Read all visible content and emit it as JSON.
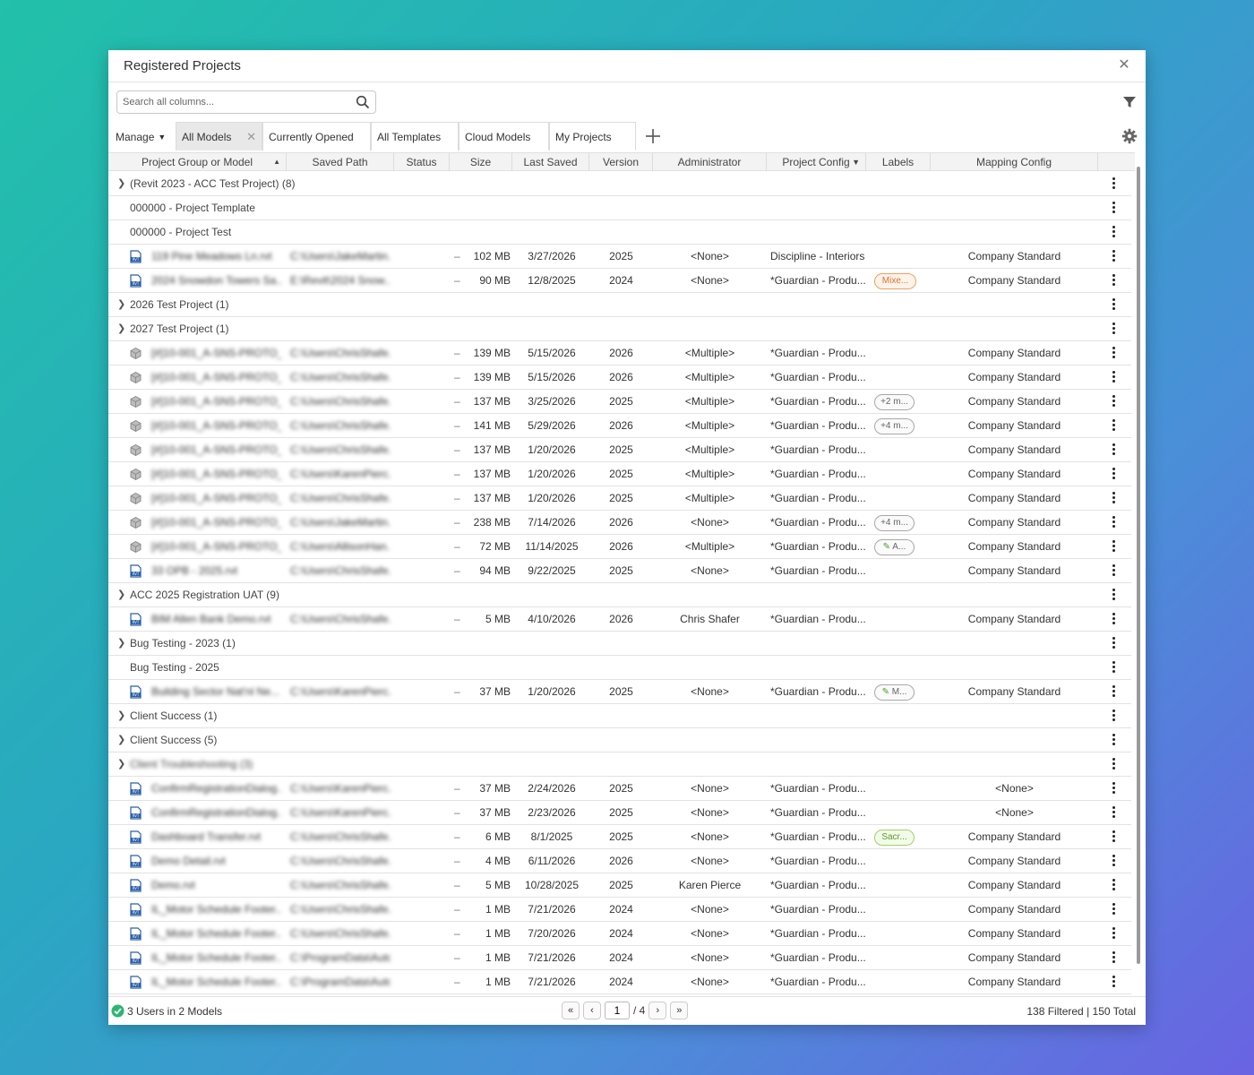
{
  "window": {
    "title": "Registered Projects"
  },
  "search": {
    "placeholder": "Search all columns..."
  },
  "manage_label": "Manage",
  "tabs": [
    {
      "label": "All Models",
      "active": true,
      "closable": true
    },
    {
      "label": "Currently Opened",
      "active": false
    },
    {
      "label": "All Templates",
      "active": false
    },
    {
      "label": "Cloud Models",
      "active": false
    },
    {
      "label": "My Projects",
      "active": false
    }
  ],
  "columns": [
    "Project Group or Model",
    "Saved Path",
    "Status",
    "Size",
    "Last Saved",
    "Version",
    "Administrator",
    "Project Config",
    "Labels",
    "Mapping Config"
  ],
  "rows": [
    {
      "type": "group",
      "caret": true,
      "name": "(Revit 2023 - ACC Test Project) (8)"
    },
    {
      "type": "group",
      "caret": false,
      "name": "000000 - Project Template"
    },
    {
      "type": "group",
      "caret": false,
      "name": "000000 - Project Test"
    },
    {
      "type": "model",
      "icon": "rvt",
      "name": "119 Pine Meadows Ln.rvt",
      "path": "C:\\Users\\JakeMartin...",
      "status": "–",
      "size": "102 MB",
      "saved": "3/27/2026",
      "version": "2025",
      "admin": "<None>",
      "config": "Discipline - Interiors",
      "config_blue": false,
      "label": "",
      "label_style": "",
      "mapping": "Company Standard"
    },
    {
      "type": "model",
      "icon": "rvt",
      "name": "2024 Snowdon Towers Sa...",
      "path": "E:\\Revit\\2024 Snow...",
      "status": "–",
      "size": "90 MB",
      "saved": "12/8/2025",
      "version": "2024",
      "admin": "<None>",
      "config": "*Guardian - Produ...",
      "config_blue": false,
      "label": "Mixe...",
      "label_style": "orange",
      "mapping": "Company Standard"
    },
    {
      "type": "group",
      "caret": true,
      "name": "2026 Test Project (1)"
    },
    {
      "type": "group",
      "caret": true,
      "name": "2027 Test Project (1)"
    },
    {
      "type": "model",
      "icon": "cloud",
      "name": "[#]10-001_A-SNS-PROTO_...",
      "path": "C:\\Users\\ChrisShafe...",
      "status": "–",
      "size": "139 MB",
      "saved": "5/15/2026",
      "version": "2026",
      "admin": "<Multiple>",
      "config": "*Guardian - Produ...",
      "config_blue": false,
      "label": "",
      "label_style": "",
      "mapping": "Company Standard"
    },
    {
      "type": "model",
      "icon": "cloud",
      "name": "[#]10-001_A-SNS-PROTO_...",
      "path": "C:\\Users\\ChrisShafe...",
      "status": "–",
      "size": "139 MB",
      "saved": "5/15/2026",
      "version": "2026",
      "admin": "<Multiple>",
      "config": "*Guardian - Produ...",
      "config_blue": false,
      "label": "",
      "label_style": "",
      "mapping": "Company Standard"
    },
    {
      "type": "model",
      "icon": "cloud",
      "name": "[#]10-001_A-SNS-PROTO_...",
      "path": "C:\\Users\\ChrisShafe...",
      "status": "–",
      "size": "137 MB",
      "saved": "3/25/2026",
      "version": "2025",
      "admin": "<Multiple>",
      "config": "*Guardian - Produ...",
      "config_blue": false,
      "label": "+2 m...",
      "label_style": "gray",
      "mapping": "Company Standard"
    },
    {
      "type": "model",
      "icon": "cloud",
      "name": "[#]10-001_A-SNS-PROTO_...",
      "path": "C:\\Users\\ChrisShafe...",
      "status": "–",
      "size": "141 MB",
      "saved": "5/29/2026",
      "version": "2026",
      "admin": "<Multiple>",
      "config": "*Guardian - Produ...",
      "config_blue": true,
      "label": "+4 m...",
      "label_style": "gray",
      "mapping": "Company Standard"
    },
    {
      "type": "model",
      "icon": "cloud",
      "name": "[#]10-001_A-SNS-PROTO_...",
      "path": "C:\\Users\\ChrisShafe...",
      "status": "–",
      "size": "137 MB",
      "saved": "1/20/2026",
      "version": "2025",
      "admin": "<Multiple>",
      "config": "*Guardian - Produ...",
      "config_blue": true,
      "label": "",
      "label_style": "",
      "mapping": "Company Standard"
    },
    {
      "type": "model",
      "icon": "cloud",
      "name": "[#]10-001_A-SNS-PROTO_...",
      "path": "C:\\Users\\KarenPierc...",
      "status": "–",
      "size": "137 MB",
      "saved": "1/20/2026",
      "version": "2025",
      "admin": "<Multiple>",
      "config": "*Guardian - Produ...",
      "config_blue": true,
      "label": "",
      "label_style": "",
      "mapping": "Company Standard"
    },
    {
      "type": "model",
      "icon": "cloud",
      "name": "[#]10-001_A-SNS-PROTO_...",
      "path": "C:\\Users\\ChrisShafe...",
      "status": "–",
      "size": "137 MB",
      "saved": "1/20/2026",
      "version": "2025",
      "admin": "<Multiple>",
      "config": "*Guardian - Produ...",
      "config_blue": true,
      "label": "",
      "label_style": "",
      "mapping": "Company Standard"
    },
    {
      "type": "model",
      "icon": "cloud",
      "name": "[#]10-001_A-SNS-PROTO_...",
      "path": "C:\\Users\\JakeMartin...",
      "status": "–",
      "size": "238 MB",
      "saved": "7/14/2026",
      "version": "2026",
      "admin": "<None>",
      "config": "*Guardian - Produ...",
      "config_blue": false,
      "label": "+4 m...",
      "label_style": "gray",
      "mapping": "Company Standard"
    },
    {
      "type": "model",
      "icon": "cloud",
      "name": "[#]10-001_A-SNS-PROTO_...",
      "path": "C:\\Users\\AllisonHan...",
      "status": "–",
      "size": "72 MB",
      "saved": "11/14/2025",
      "version": "2026",
      "admin": "<Multiple>",
      "config": "*Guardian - Produ...",
      "config_blue": false,
      "label": "A...",
      "label_style": "gray",
      "mapping": "Company Standard"
    },
    {
      "type": "model",
      "icon": "rvt",
      "name": "33 OPB - 2025.rvt",
      "path": "C:\\Users\\ChrisShafe...",
      "status": "–",
      "size": "94 MB",
      "saved": "9/22/2025",
      "version": "2025",
      "admin": "<None>",
      "config": "*Guardian - Produ...",
      "config_blue": false,
      "label": "",
      "label_style": "",
      "mapping": "Company Standard"
    },
    {
      "type": "group",
      "caret": true,
      "name": "ACC 2025 Registration UAT (9)"
    },
    {
      "type": "model",
      "icon": "rvt",
      "name": "BIM Allen Bank Demo.rvt",
      "path": "C:\\Users\\ChrisShafe...",
      "status": "–",
      "size": "5 MB",
      "saved": "4/10/2026",
      "version": "2026",
      "admin": "Chris Shafer",
      "config": "*Guardian - Produ...",
      "config_blue": false,
      "label": "",
      "label_style": "",
      "mapping": "Company Standard"
    },
    {
      "type": "group",
      "caret": true,
      "name": "Bug Testing - 2023 (1)"
    },
    {
      "type": "group",
      "caret": false,
      "name": "Bug Testing - 2025"
    },
    {
      "type": "model",
      "icon": "rvt",
      "name": "Building Sector Nat'nl Ne...",
      "path": "C:\\Users\\KarenPierc...",
      "status": "–",
      "size": "37 MB",
      "saved": "1/20/2026",
      "version": "2025",
      "admin": "<None>",
      "config": "*Guardian - Produ...",
      "config_blue": false,
      "label": "M...",
      "label_style": "gray",
      "mapping": "Company Standard"
    },
    {
      "type": "group",
      "caret": true,
      "name": "Client Success (1)"
    },
    {
      "type": "group",
      "caret": true,
      "name": "Client Success (5)"
    },
    {
      "type": "group",
      "caret": true,
      "name": "Client Troubleshooting (3)",
      "blurred": true
    },
    {
      "type": "model",
      "icon": "rvt",
      "name": "ConfirmRegistrationDialog...",
      "path": "C:\\Users\\KarenPierc...",
      "status": "–",
      "size": "37 MB",
      "saved": "2/24/2026",
      "version": "2025",
      "admin": "<None>",
      "config": "*Guardian - Produ...",
      "config_blue": false,
      "label": "",
      "label_style": "",
      "mapping": "<None>"
    },
    {
      "type": "model",
      "icon": "rvt",
      "name": "ConfirmRegistrationDialog...",
      "path": "C:\\Users\\KarenPierc...",
      "status": "–",
      "size": "37 MB",
      "saved": "2/23/2026",
      "version": "2025",
      "admin": "<None>",
      "config": "*Guardian - Produ...",
      "config_blue": false,
      "label": "",
      "label_style": "",
      "mapping": "<None>"
    },
    {
      "type": "model",
      "icon": "rvt",
      "name": "Dashboard Transfer.rvt",
      "path": "C:\\Users\\ChrisShafe...",
      "status": "–",
      "size": "6 MB",
      "saved": "8/1/2025",
      "version": "2025",
      "admin": "<None>",
      "config": "*Guardian - Produ...",
      "config_blue": false,
      "label": "Sacr...",
      "label_style": "green",
      "mapping": "Company Standard"
    },
    {
      "type": "model",
      "icon": "rvt",
      "name": "Demo Detail.rvt",
      "path": "C:\\Users\\ChrisShafe...",
      "status": "–",
      "size": "4 MB",
      "saved": "6/11/2026",
      "version": "2026",
      "admin": "<None>",
      "config": "*Guardian - Produ...",
      "config_blue": false,
      "label": "",
      "label_style": "",
      "mapping": "Company Standard"
    },
    {
      "type": "model",
      "icon": "rvt",
      "name": "Demo.rvt",
      "path": "C:\\Users\\ChrisShafe...",
      "status": "–",
      "size": "5 MB",
      "saved": "10/28/2025",
      "version": "2025",
      "admin": "Karen Pierce",
      "config": "*Guardian - Produ...",
      "config_blue": false,
      "label": "",
      "label_style": "",
      "mapping": "Company Standard"
    },
    {
      "type": "model",
      "icon": "rvt",
      "name": "IL_Motor Schedule Footer...",
      "path": "C:\\Users\\ChrisShafe...",
      "status": "–",
      "size": "1 MB",
      "saved": "7/21/2026",
      "version": "2024",
      "admin": "<None>",
      "config": "*Guardian - Produ...",
      "config_blue": false,
      "label": "",
      "label_style": "",
      "mapping": "Company Standard"
    },
    {
      "type": "model",
      "icon": "rvt",
      "name": "IL_Motor Schedule Footer...",
      "path": "C:\\Users\\ChrisShafe...",
      "status": "–",
      "size": "1 MB",
      "saved": "7/20/2026",
      "version": "2024",
      "admin": "<None>",
      "config": "*Guardian - Produ...",
      "config_blue": false,
      "label": "",
      "label_style": "",
      "mapping": "Company Standard"
    },
    {
      "type": "model",
      "icon": "rvt",
      "name": "IL_Motor Schedule Footer...",
      "path": "C:\\ProgramData\\Auto...",
      "status": "–",
      "size": "1 MB",
      "saved": "7/21/2026",
      "version": "2024",
      "admin": "<None>",
      "config": "*Guardian - Produ...",
      "config_blue": false,
      "label": "",
      "label_style": "",
      "mapping": "Company Standard"
    },
    {
      "type": "model",
      "icon": "rvt",
      "name": "IL_Motor Schedule Footer...",
      "path": "C:\\ProgramData\\Auto...",
      "status": "–",
      "size": "1 MB",
      "saved": "7/21/2026",
      "version": "2024",
      "admin": "<None>",
      "config": "*Guardian - Produ...",
      "config_blue": false,
      "label": "",
      "label_style": "",
      "mapping": "Company Standard"
    }
  ],
  "footer": {
    "status": "3 Users in 2 Models",
    "page_current": "1",
    "page_total": "/ 4",
    "counts": "138 Filtered | 150 Total"
  },
  "colors": {
    "accent_blue": "#3b7bd0",
    "status_green": "#2bb673",
    "rvt_blue": "#2a5fa8"
  }
}
